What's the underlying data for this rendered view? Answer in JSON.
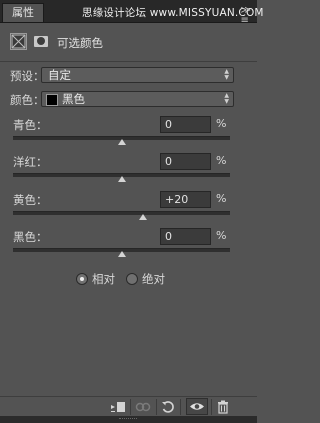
{
  "header": {
    "tab_label": "属性",
    "watermark": "思缘设计论坛 www.MISSYUAN.COM",
    "menu_icon": "panel-menu-icon"
  },
  "adjustment": {
    "title": "可选颜色",
    "icon": "selective-color-adjustment-icon",
    "mask_icon": "layer-mask-icon"
  },
  "preset": {
    "label": "预设：",
    "value": "自定"
  },
  "colors": {
    "label": "颜色：",
    "value": "黑色",
    "swatch_color": "#000000"
  },
  "sliders": [
    {
      "label": "青色：",
      "value": "0",
      "unit": "%",
      "level": 0
    },
    {
      "label": "洋红：",
      "value": "0",
      "unit": "%",
      "level": 0
    },
    {
      "label": "黄色：",
      "value": "+20",
      "unit": "%",
      "level": 20
    },
    {
      "label": "黑色：",
      "value": "0",
      "unit": "%",
      "level": 0
    }
  ],
  "slider_range": [
    -100,
    100
  ],
  "method": {
    "relative": {
      "label": "相对",
      "selected": true
    },
    "absolute": {
      "label": "绝对",
      "selected": false
    }
  },
  "footer_icons": [
    "clip-to-layer-icon",
    "view-previous-state-icon",
    "reset-icon",
    "visibility-eye-icon",
    "trash-icon"
  ]
}
